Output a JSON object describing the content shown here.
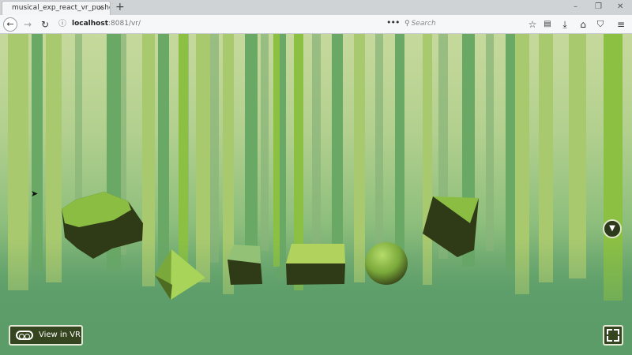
{
  "browser": {
    "tab_title": "musical_exp_react_vr_pusher",
    "tab_close_glyph": "×",
    "new_tab_glyph": "+",
    "window_controls": {
      "minimize": "–",
      "restore": "❐",
      "close": "✕"
    },
    "url_host": "localhost",
    "url_port": ":8081",
    "url_path": "/vr/",
    "page_actions_glyph": "•••",
    "search_placeholder": "Search",
    "toolbar_icons": [
      "back-icon",
      "forward-icon",
      "reload-icon",
      "info-icon",
      "bookmark-star-icon",
      "reading-list-icon",
      "download-icon",
      "home-icon",
      "pocket-icon",
      "menu-icon"
    ]
  },
  "scene": {
    "objects": [
      "cylinder",
      "pyramid",
      "cube",
      "box",
      "sphere",
      "rotated-cube"
    ],
    "colors": {
      "sky": "#c6d99c",
      "ground": "#5a9a68",
      "object_light": "#8bbd43",
      "object_dark": "#2f3b16"
    }
  },
  "controls": {
    "vr_label": "View in VR",
    "gaze_glyph": "▼"
  }
}
